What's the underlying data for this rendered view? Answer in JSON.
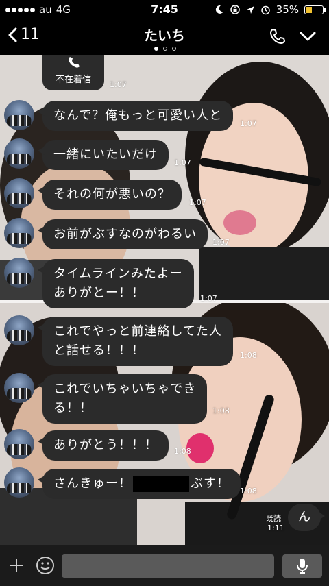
{
  "status_bar": {
    "carrier": "au",
    "network": "4G",
    "time": "7:45",
    "battery": "35%"
  },
  "header": {
    "back_count": "11",
    "title": "たいち"
  },
  "messages": [
    {
      "type": "missed_call",
      "label": "不在着信",
      "time": "1:07"
    },
    {
      "text": "なんで？俺もっと可愛い人と",
      "time": "1:07"
    },
    {
      "text": "一緒にいたいだけ",
      "time": "1:07"
    },
    {
      "text": "それの何が悪いの？",
      "time": "1:07"
    },
    {
      "text": "お前がぶすなのがわるい",
      "time": "1:07"
    },
    {
      "text": "タイムラインみたよー\nありがとー！！",
      "time": "1:07"
    },
    {
      "text": "これでやっと前連絡してた人\nと話せる！！！",
      "time": "1:08"
    },
    {
      "text": "これでいちゃいちゃでき\nる！！",
      "time": "1:08"
    },
    {
      "text": "ありがとう！！！",
      "time": "1:08"
    },
    {
      "text_before": "さんきゅー！",
      "text_after": "ぶす！",
      "time": "1:08"
    }
  ],
  "sent_message": {
    "text": "ん",
    "read_label": "既読",
    "time": "1:11"
  },
  "colors": {
    "bubble": "#2b2b2b",
    "battery": "#f2c230",
    "input_field": "#5a5a5a"
  }
}
